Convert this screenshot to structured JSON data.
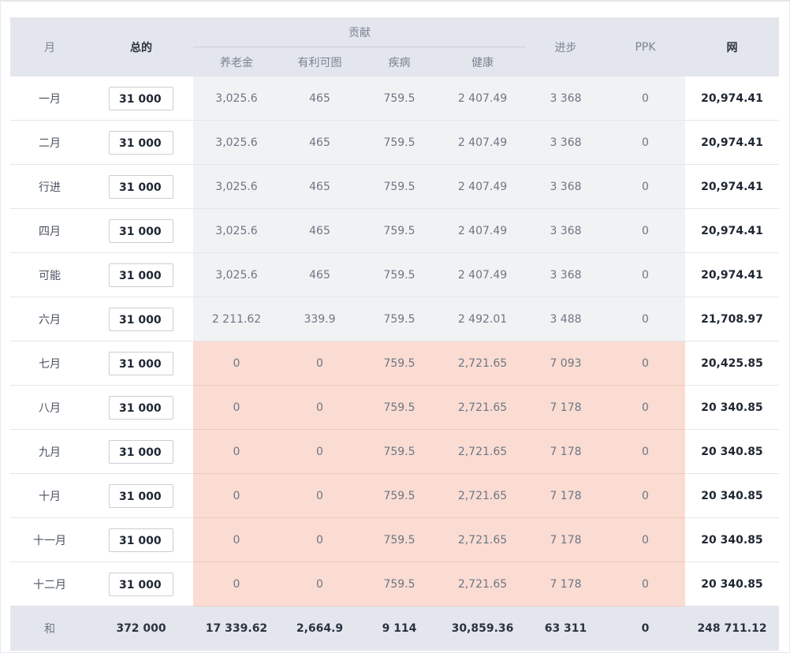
{
  "header": {
    "month": "月",
    "total": "总的",
    "contributions": "贡献",
    "pension": "养老金",
    "disability": "有利可图",
    "sickness": "疾病",
    "health": "健康",
    "advance": "进步",
    "ppk": "PPK",
    "net": "网"
  },
  "rows": [
    {
      "month": "一月",
      "total": "31 000",
      "pension": "3,025.6",
      "disability": "465",
      "sickness": "759.5",
      "health": "2 407.49",
      "advance": "3 368",
      "ppk": "0",
      "net": "20,974.41"
    },
    {
      "month": "二月",
      "total": "31 000",
      "pension": "3,025.6",
      "disability": "465",
      "sickness": "759.5",
      "health": "2 407.49",
      "advance": "3 368",
      "ppk": "0",
      "net": "20,974.41"
    },
    {
      "month": "行进",
      "total": "31 000",
      "pension": "3,025.6",
      "disability": "465",
      "sickness": "759.5",
      "health": "2 407.49",
      "advance": "3 368",
      "ppk": "0",
      "net": "20,974.41"
    },
    {
      "month": "四月",
      "total": "31 000",
      "pension": "3,025.6",
      "disability": "465",
      "sickness": "759.5",
      "health": "2 407.49",
      "advance": "3 368",
      "ppk": "0",
      "net": "20,974.41"
    },
    {
      "month": "可能",
      "total": "31 000",
      "pension": "3,025.6",
      "disability": "465",
      "sickness": "759.5",
      "health": "2 407.49",
      "advance": "3 368",
      "ppk": "0",
      "net": "20,974.41"
    },
    {
      "month": "六月",
      "total": "31 000",
      "pension": "2 211.62",
      "disability": "339.9",
      "sickness": "759.5",
      "health": "2 492.01",
      "advance": "3 488",
      "ppk": "0",
      "net": "21,708.97"
    },
    {
      "month": "七月",
      "total": "31 000",
      "pension": "0",
      "disability": "0",
      "sickness": "759.5",
      "health": "2,721.65",
      "advance": "7 093",
      "ppk": "0",
      "net": "20,425.85"
    },
    {
      "month": "八月",
      "total": "31 000",
      "pension": "0",
      "disability": "0",
      "sickness": "759.5",
      "health": "2,721.65",
      "advance": "7 178",
      "ppk": "0",
      "net": "20 340.85"
    },
    {
      "month": "九月",
      "total": "31 000",
      "pension": "0",
      "disability": "0",
      "sickness": "759.5",
      "health": "2,721.65",
      "advance": "7 178",
      "ppk": "0",
      "net": "20 340.85"
    },
    {
      "month": "十月",
      "total": "31 000",
      "pension": "0",
      "disability": "0",
      "sickness": "759.5",
      "health": "2,721.65",
      "advance": "7 178",
      "ppk": "0",
      "net": "20 340.85"
    },
    {
      "month": "十一月",
      "total": "31 000",
      "pension": "0",
      "disability": "0",
      "sickness": "759.5",
      "health": "2,721.65",
      "advance": "7 178",
      "ppk": "0",
      "net": "20 340.85"
    },
    {
      "month": "十二月",
      "total": "31 000",
      "pension": "0",
      "disability": "0",
      "sickness": "759.5",
      "health": "2,721.65",
      "advance": "7 178",
      "ppk": "0",
      "net": "20 340.85"
    }
  ],
  "footer": {
    "label": "和",
    "total": "372 000",
    "pension": "17 339.62",
    "disability": "2,664.9",
    "sickness": "9 114",
    "health": "30,859.36",
    "advance": "63 311",
    "ppk": "0",
    "net": "248 711.12"
  },
  "colors": {
    "header_bg": "#e3e6ec",
    "normal_contrib_bg": "#f1f2f4",
    "highlight_contrib_bg": "#fadcd3"
  }
}
